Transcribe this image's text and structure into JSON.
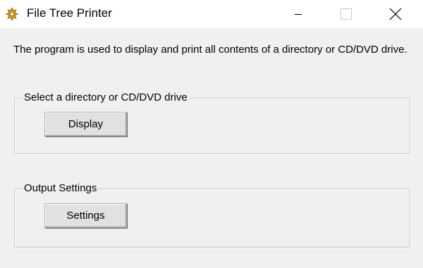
{
  "window": {
    "title": "File Tree Printer",
    "app_icon": "gear-icon",
    "controls": {
      "minimize_icon": "minimize-icon",
      "maximize_icon": "maximize-icon",
      "close_icon": "close-icon"
    }
  },
  "main": {
    "description": "The program is used to display and print all contents of a directory or CD/DVD drive."
  },
  "groups": {
    "select": {
      "label": "Select a directory or CD/DVD drive",
      "button_label": "Display"
    },
    "output": {
      "label": "Output Settings",
      "button_label": "Settings"
    }
  },
  "colors": {
    "window_background": "#f0f0f0",
    "titlebar_background": "#ffffff",
    "button_face": "#e1e1e1",
    "groupbox_border": "#c4c4c4",
    "icon_color": "#d4a017"
  }
}
